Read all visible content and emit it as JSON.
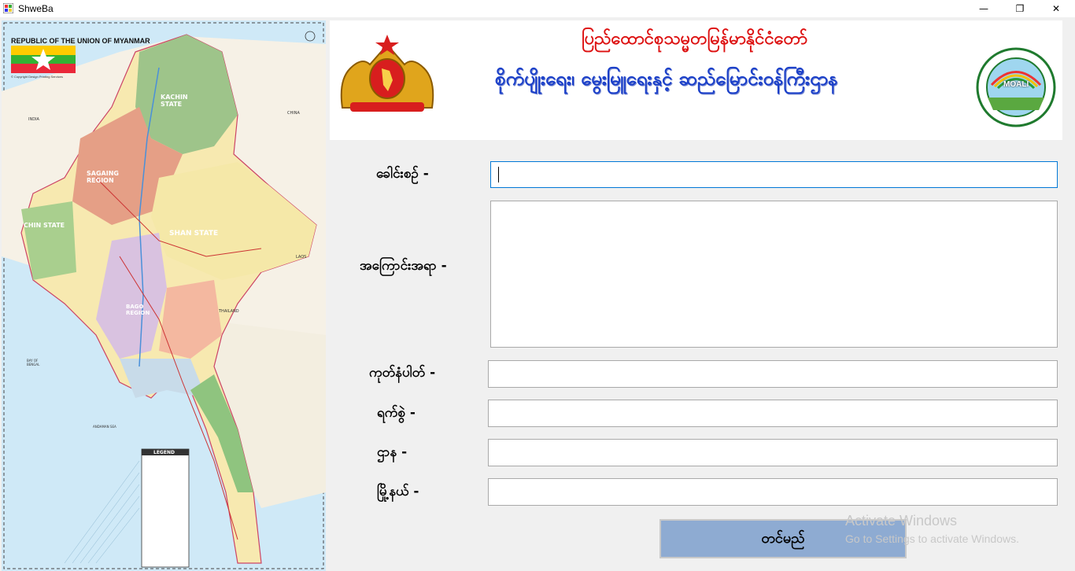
{
  "window": {
    "title": "ShweBa",
    "controls": {
      "minimize": "—",
      "maximize": "❐",
      "close": "✕"
    }
  },
  "map": {
    "title": "REPUBLIC OF THE UNION OF MYANMAR",
    "copyright": "© Copyright Design Printing Services",
    "labels": {
      "kachin": "KACHIN STATE",
      "sagaing": "SAGAING REGION",
      "chin": "CHIN STATE",
      "shan": "SHAN STATE",
      "bago": "BAGO REGION",
      "india": "INDIA",
      "china": "CHINA",
      "laos": "LAOS",
      "thailand": "THAILAND",
      "bay": "BAY OF BENGAL",
      "andaman": "ANDAMAN SEA",
      "legend": "LEGEND"
    }
  },
  "banner": {
    "line1": "ပြည်ထောင်စုသမ္မတမြန်မာနိုင်ငံတော်",
    "line2": "စိုက်ပျိုးရေး၊ မွေးမြူရေးနှင့် ဆည်မြောင်းဝန်ကြီးဌာန",
    "logo_text": "MOALI"
  },
  "form": {
    "title_label": "ခေါင်းစဉ်  -",
    "title_value": "",
    "content_label": "အကြောင်းအရာ -",
    "content_value": "",
    "code_label": "ကုတ်နံပါတ် -",
    "code_value": "",
    "date_label": "ရက်စွဲ -",
    "date_value": "",
    "department_label": "ဌာန -",
    "department_value": "",
    "city_label": "မြို့နယ် -",
    "city_value": "",
    "submit_label": "တင်မည်"
  },
  "watermark": {
    "line1": "Activate Windows",
    "line2": "Go to Settings to activate Windows."
  },
  "colors": {
    "button_bg": "#8eabd2",
    "banner_red": "#dd1111",
    "banner_blue": "#1a3fc9"
  }
}
